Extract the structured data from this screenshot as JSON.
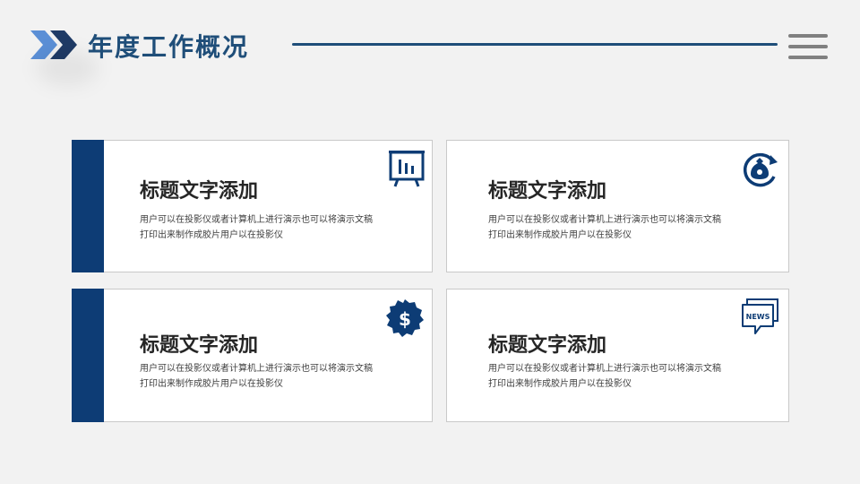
{
  "slide": {
    "title": "年度工作概况",
    "colors": {
      "accent": "#1f4e79",
      "card_bar": "#0d3c75",
      "icon": "#0d3c75",
      "chevron_light": "#5b8fd6",
      "chevron_dark": "#1f3b66",
      "menu": "#808080"
    },
    "menu_icon": "hamburger-menu-icon"
  },
  "cards": [
    {
      "title": "标题文字添加",
      "line1": "用户可以在投影仪或者计算机上进行演示也可以将演示文稿",
      "line2": "打印出来制作成胶片用户以在投影仪",
      "icon": "presentation-board-icon"
    },
    {
      "title": "标题文字添加",
      "line1": "用户可以在投影仪或者计算机上进行演示也可以将演示文稿",
      "line2": "打印出来制作成胶片用户以在投影仪",
      "icon": "money-bag-cycle-icon"
    },
    {
      "title": "标题文字添加",
      "line1": "用户可以在投影仪或者计算机上进行演示也可以将演示文稿",
      "line2": "打印出来制作成胶片用户以在投影仪",
      "icon": "dollar-badge-icon"
    },
    {
      "title": "标题文字添加",
      "line1": "用户可以在投影仪或者计算机上进行演示也可以将演示文稿",
      "line2": "打印出来制作成胶片用户以在投影仪",
      "icon": "news-chat-icon",
      "icon_text": "NEWS"
    }
  ]
}
